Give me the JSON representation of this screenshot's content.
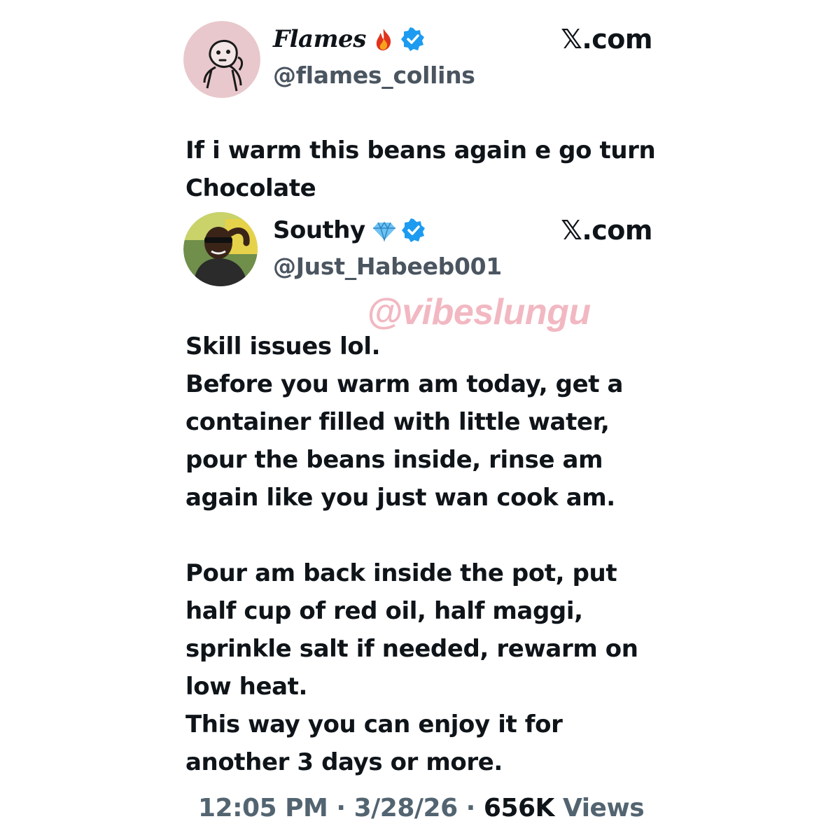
{
  "quoted_tweet": {
    "author": {
      "display_name": "Flames",
      "name_emoji": "fire-icon",
      "verified_icon": "verified-badge-icon",
      "handle": "@flames_collins",
      "avatar_icon": "cartoon-avatar"
    },
    "source": "𝕏.com",
    "text": "If i warm this beans again e go turn\nChocolate"
  },
  "reply_tweet": {
    "author": {
      "display_name": "Southy",
      "name_emoji": "diamond-icon",
      "verified_icon": "verified-badge-icon",
      "handle": "@Just_Habeeb001",
      "avatar_icon": "photo-avatar"
    },
    "source": "𝕏.com",
    "text": "Skill issues lol.\nBefore you warm am today, get a\ncontainer filled with little water,\npour the beans inside, rinse am\nagain like you just wan cook am.\n\nPour am back inside the pot, put\nhalf cup of red oil, half maggi,\nsprinkle salt if needed, rewarm on\nlow heat.\nThis way you can enjoy it for\nanother 3 days or more."
  },
  "watermark": "@vibeslungu",
  "meta": {
    "time": "12:05 PM",
    "separator": " · ",
    "date": "3/28/26",
    "views_count": "656K",
    "views_label": " Views"
  },
  "colors": {
    "verified_blue": "#1d9bf0",
    "watermark_pink": "#f2b8c2",
    "meta_gray": "#536471"
  }
}
